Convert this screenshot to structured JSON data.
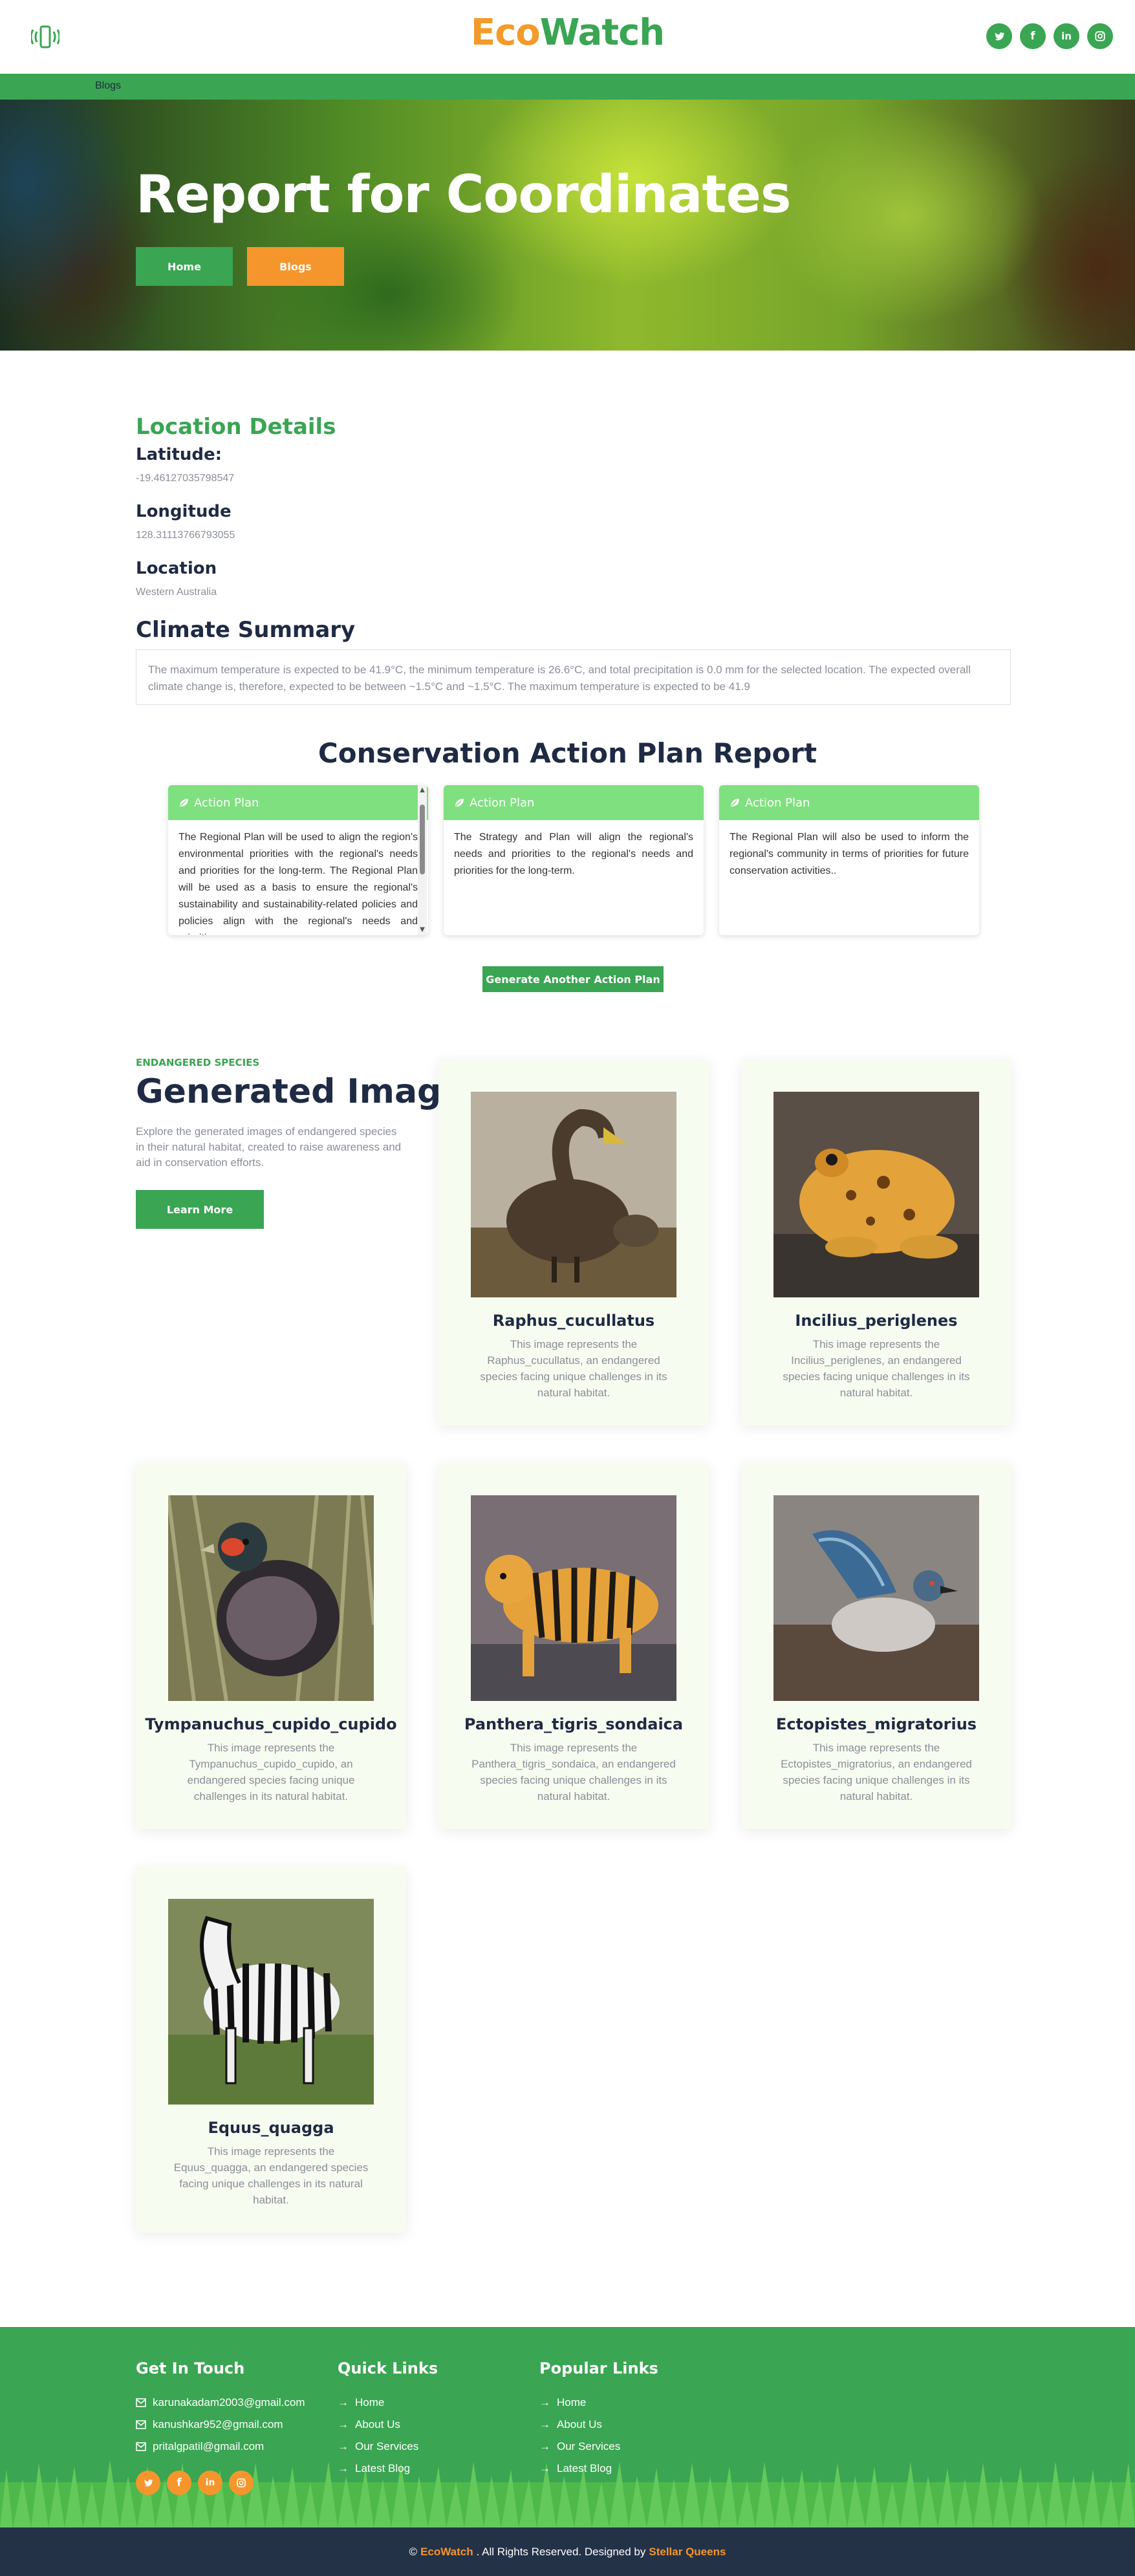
{
  "brand": {
    "part1": "Eco",
    "part2": "Watch"
  },
  "header": {
    "social": [
      "twitter-icon",
      "facebook-icon",
      "linkedin-icon",
      "instagram-icon"
    ]
  },
  "breadcrumb": "Blogs",
  "hero": {
    "title": "Report for Coordinates",
    "home_label": "Home",
    "blogs_label": "Blogs"
  },
  "location": {
    "title": "Location Details",
    "latitude_label": "Latitude:",
    "latitude_value": "-19.46127035798547",
    "longitude_label": "Longitude",
    "longitude_value": "128.31113766793055",
    "location_label": "Location",
    "location_value": "Western Australia"
  },
  "climate": {
    "title": "Climate Summary",
    "text": "The maximum temperature is expected to be 41.9°C, the minimum temperature is 26.6°C, and total precipitation is 0.0 mm for the selected location. The expected overall climate change is, therefore, expected to be between ~1.5°C and ~1.5°C. The maximum temperature is expected to be 41.9"
  },
  "action_plan": {
    "title": "Conservation Action Plan Report",
    "cards": [
      {
        "header": "Action Plan",
        "text": "The Regional Plan will be used to align the region's environmental priorities with the regional's needs and priorities for the long-term. The Regional Plan will be used as a basis to ensure the regional's sustainability and sustainability-related policies and policies align with the regional's needs and priorities."
      },
      {
        "header": "Action Plan",
        "text": "The Strategy and Plan will align the regional's needs and priorities to the regional's needs and priorities for the long-term."
      },
      {
        "header": "Action Plan",
        "text": "The Regional Plan will also be used to inform the regional's community in terms of priorities for future conservation activities.."
      }
    ],
    "generate_label": "Generate Another Action Plan"
  },
  "generated": {
    "eyebrow": "ENDANGERED SPECIES",
    "title": "Generated Images",
    "description": "Explore the generated images of endangered species in their natural habitat, created to raise awareness and aid in conservation efforts.",
    "learn_more": "Learn More",
    "species": [
      {
        "name": "Raphus_cucullatus",
        "desc": "This image represents the Raphus_cucullatus, an endangered species facing unique challenges in its natural habitat."
      },
      {
        "name": "Incilius_periglenes",
        "desc": "This image represents the Incilius_periglenes, an endangered species facing unique challenges in its natural habitat."
      },
      {
        "name": "Tympanuchus_cupido_cupido",
        "desc": "This image represents the Tympanuchus_cupido_cupido, an endangered species facing unique challenges in its natural habitat."
      },
      {
        "name": "Panthera_tigris_sondaica",
        "desc": "This image represents the Panthera_tigris_sondaica, an endangered species facing unique challenges in its natural habitat."
      },
      {
        "name": "Ectopistes_migratorius",
        "desc": "This image represents the Ectopistes_migratorius, an endangered species facing unique challenges in its natural habitat."
      },
      {
        "name": "Equus_quagga",
        "desc": "This image represents the Equus_quagga, an endangered species facing unique challenges in its natural habitat."
      }
    ]
  },
  "footer": {
    "contact_title": "Get In Touch",
    "emails": [
      "karunakadam2003@gmail.com",
      "kanushkar952@gmail.com",
      "pritalgpatil@gmail.com"
    ],
    "quick_title": "Quick Links",
    "quick_links": [
      "Home",
      "About Us",
      "Our Services",
      "Latest Blog"
    ],
    "popular_title": "Popular Links",
    "popular_links": [
      "Home",
      "About Us",
      "Our Services",
      "Latest Blog"
    ],
    "copyright_prefix": "©",
    "copyright_brand": "EcoWatch",
    "copyright_mid": ". All Rights Reserved. Designed by",
    "copyright_designer": "Stellar Queens"
  },
  "colors": {
    "green": "#3aa552",
    "orange": "#f5962c",
    "navy": "#243248",
    "action_header": "#7fe07f"
  }
}
